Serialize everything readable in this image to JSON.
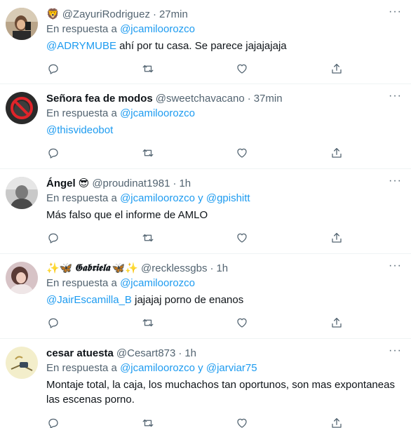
{
  "colors": {
    "link": "#1d9bf0",
    "secondary_text": "#536471",
    "primary_text": "#0f1419"
  },
  "icons": {
    "reply": "reply-icon",
    "retweet": "retweet-icon",
    "like": "heart-icon",
    "share": "share-icon",
    "more": "more-icon"
  },
  "tweets": [
    {
      "emoji": "🦁",
      "display_name": "",
      "handle": "@ZayuriRodriguez",
      "separator": "·",
      "time": "27min",
      "more": "···",
      "reply_prefix": "En respuesta a",
      "reply_to": "@jcamiloorozco",
      "mention": "@ADRYMUBE",
      "text": " ahí por tu casa. Se parece jajajajaja"
    },
    {
      "display_name": "Señora fea de modos",
      "handle": "@sweetchavacano",
      "separator": "·",
      "time": "37min",
      "more": "···",
      "reply_prefix": "En respuesta a",
      "reply_to": "@jcamiloorozco",
      "mention": "@thisvideobot",
      "text": ""
    },
    {
      "display_name": "Ángel",
      "emoji": "😎",
      "handle": "@proudinat1981",
      "separator": "·",
      "time": "1h",
      "more": "···",
      "reply_prefix": "En respuesta a",
      "reply_to": "@jcamiloorozco y @gpishitt",
      "text": "Más falso que el informe de AMLO"
    },
    {
      "emoji_left": "✨🦋",
      "display_name": "𝕲𝖆𝖇𝖗𝖎𝖊𝖑𝖆",
      "emoji_right": "🦋✨",
      "handle": "@recklessgbs",
      "separator": "·",
      "time": "1h",
      "more": "···",
      "reply_prefix": "En respuesta a",
      "reply_to": "@jcamiloorozco",
      "mention": "@JairEscamilla_B",
      "text": " jajajaj porno de enanos"
    },
    {
      "display_name": "cesar atuesta",
      "handle": "@Cesart873",
      "separator": "·",
      "time": "1h",
      "more": "···",
      "reply_prefix": "En respuesta a",
      "reply_to": "@jcamiloorozco y @jarviar75",
      "text": "Montaje total, la caja, los muchachos tan oportunos, son mas expontaneas las escenas porno."
    }
  ]
}
